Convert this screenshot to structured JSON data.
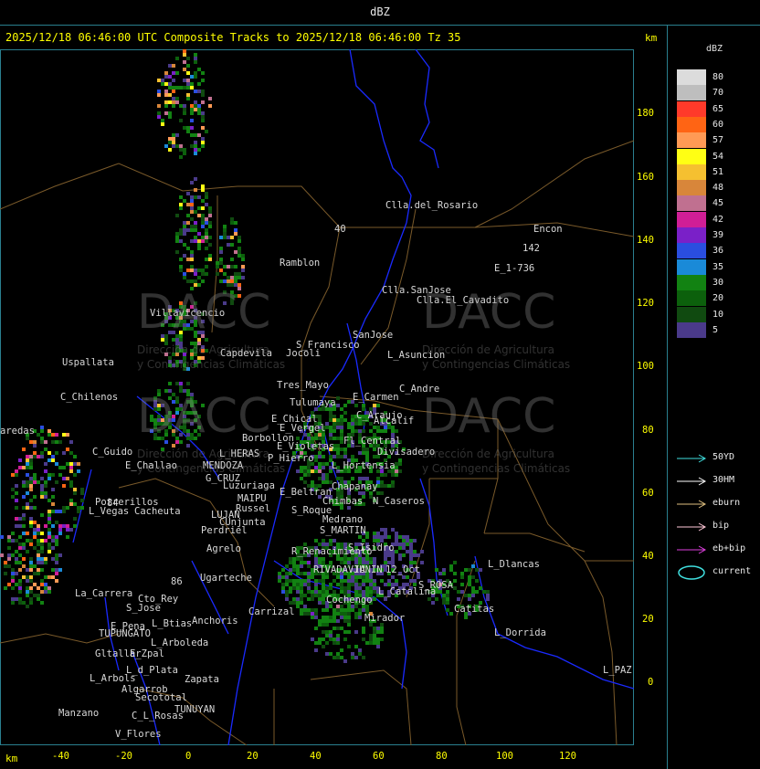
{
  "window": {
    "title": "dBZ"
  },
  "header": {
    "text": "2025/12/18 06:46:00 UTC Composite Tracks to 2025/12/18 06:46:00 Tz 35",
    "unit_top": "km",
    "unit_bottom": "km"
  },
  "axes": {
    "y_ticks": [
      "180",
      "160",
      "140",
      "120",
      "100",
      "80",
      "60",
      "40",
      "20",
      "0"
    ],
    "x_ticks": [
      "-40",
      "-20",
      "0",
      "20",
      "40",
      "60",
      "80",
      "100",
      "120"
    ]
  },
  "legend": {
    "title": "dBZ",
    "levels": [
      {
        "label": "80",
        "color": "#dcdcdc"
      },
      {
        "label": "70",
        "color": "#bebebe"
      },
      {
        "label": "65",
        "color": "#ff3a2a"
      },
      {
        "label": "60",
        "color": "#ff6414"
      },
      {
        "label": "57",
        "color": "#ff9a55"
      },
      {
        "label": "54",
        "color": "#ffff14"
      },
      {
        "label": "51",
        "color": "#f5c030"
      },
      {
        "label": "48",
        "color": "#d8863a"
      },
      {
        "label": "45",
        "color": "#c07090"
      },
      {
        "label": "42",
        "color": "#d01e96"
      },
      {
        "label": "39",
        "color": "#7a20c8"
      },
      {
        "label": "36",
        "color": "#2a4ee0"
      },
      {
        "label": "35",
        "color": "#1a8ad8"
      },
      {
        "label": "30",
        "color": "#128212"
      },
      {
        "label": "20",
        "color": "#0c600c"
      },
      {
        "label": "10",
        "color": "#104a10"
      },
      {
        "label": "5",
        "color": "#4a3a8a"
      }
    ],
    "tracks": [
      {
        "label": "50YD",
        "color": "#40e0e0"
      },
      {
        "label": "30HM",
        "color": "#ffffff"
      },
      {
        "label": "eburn",
        "color": "#e0c080"
      },
      {
        "label": "bip",
        "color": "#ffc8d8"
      },
      {
        "label": "eb+bip",
        "color": "#e040e0"
      }
    ],
    "current": {
      "label": "current",
      "color": "#40e0e0"
    }
  },
  "places": [
    "Clla.del_Rosario",
    "Encon",
    "142",
    "E_1-736",
    "Ramblon",
    "Clla.SanJose",
    "Clla.El_Cavadito",
    "40",
    "Villavicencio",
    "Capdevila",
    "Jocoli",
    "S_Francisco",
    "SanJose",
    "L_Asuncion",
    "Uspallata",
    "Tres_Mayo",
    "C_Andre",
    "E_Carmen",
    "C_Chilenos",
    "Tulumaya",
    "C_Araujo",
    "Alcalif",
    "E_Chical",
    "E_Vergel",
    "Fl_Central",
    "Divisadero",
    "aredas",
    "Borbollon",
    "E_Violetas",
    "C_Guido",
    "L_HERAS",
    "P_Hierro",
    "L_Hortensia",
    "E_Challao",
    "MENDOZA",
    "G_CRUZ",
    "Chapanay",
    "Luzuriaga",
    "MAIPU",
    "E_Beltran",
    "Chimbas",
    "N_Caseros",
    "Potrerillos",
    "Russel",
    "S_Roque",
    "L_Vegas",
    "Cacheuta",
    "LUJAN",
    "CUnjunta",
    "Medrano",
    "S_MARTIN",
    "Perdriel",
    "Agrelo",
    "R_Renacimiento",
    "S_Isidro",
    "L_Dlancas",
    "Ugarteche",
    "RIVADAVIA",
    "JUNIN",
    "12_Oct",
    "La_Carrera",
    "Cto_Rey",
    "S_Jose",
    "S_ROSA",
    "Anchoris",
    "Carrizal",
    "Cochengo",
    "L_Catalina",
    "E_Pena",
    "L_Btias",
    "TUPUNGATO",
    "Catitas",
    "L_Arboleda",
    "Mirador",
    "L_Dorrida",
    "Gltallar",
    "E_Zpal",
    "L_d_Plata",
    "L_PAZ",
    "L_Arbols",
    "Zapata",
    "Algarrob",
    "Secototal",
    "TUNUYAN",
    "Manzano",
    "C_L_Rosas",
    "V_Flores",
    "84",
    "86"
  ],
  "watermarks": {
    "brand": "DACC",
    "line1": "Dirección de Agricultura",
    "line2": "y Contingencias Climáticas"
  }
}
